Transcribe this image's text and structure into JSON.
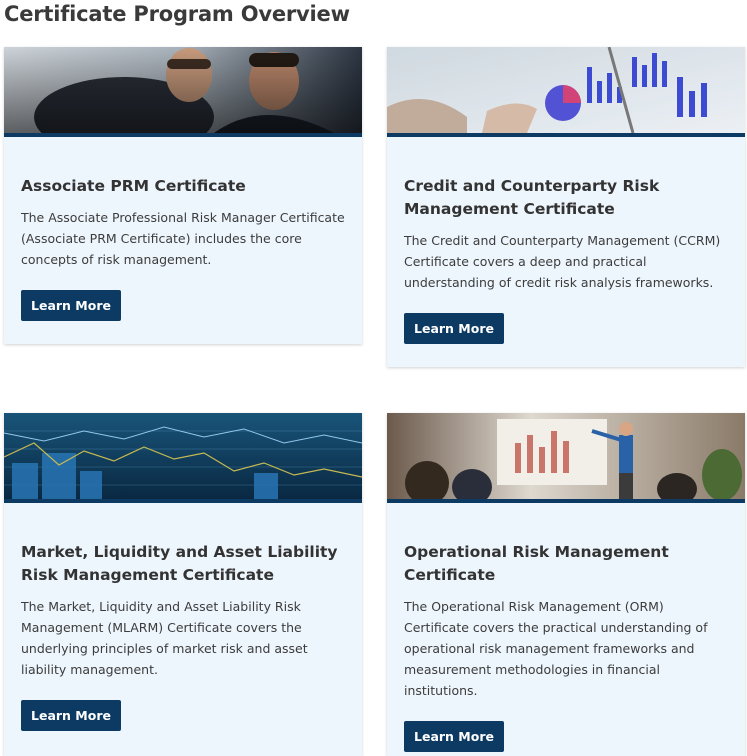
{
  "page": {
    "title": "Certificate Program Overview"
  },
  "cards": [
    {
      "title": "Associate PRM Certificate",
      "description": "The Associate Professional Risk Manager Certificate (Associate PRM Certificate) includes the core concepts of risk management.",
      "button_label": "Learn More"
    },
    {
      "title": "Credit and Counterparty Risk Management Certificate",
      "description": "The Credit and Counterparty Management (CCRM) Certificate covers a deep and practical understanding of credit risk analysis frameworks.",
      "button_label": "Learn More"
    },
    {
      "title": "Market, Liquidity and Asset Liability Risk Management Certificate",
      "description": "The Market, Liquidity and Asset Liability Risk Management (MLARM) Certificate covers the underlying principles of market risk and asset liability management.",
      "button_label": "Learn More"
    },
    {
      "title": "Operational Risk Management Certificate",
      "description": "The Operational Risk Management (ORM) Certificate covers the practical understanding of operational risk management frameworks and measurement methodologies in financial institutions.",
      "button_label": "Learn More"
    }
  ]
}
